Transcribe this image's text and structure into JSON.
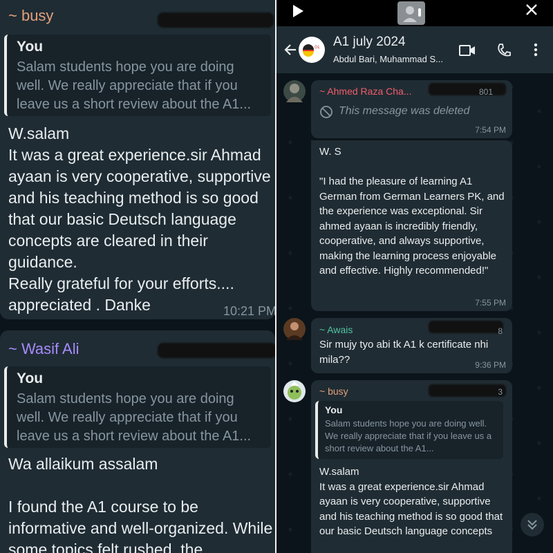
{
  "left": {
    "msg1": {
      "sender": "~ busy",
      "quote_name": "You",
      "quote_text": "Salam students hope you are doing well. We really appreciate that if you leave us a short review about the A1...",
      "body": "W.salam\nIt was a great experience.sir Ahmad ayaan is very cooperative, supportive and his teaching method is so good that our basic Deutsch language concepts are cleared in their guidance.\nReally grateful for your efforts.... appreciated . Danke",
      "time": "10:21 PM"
    },
    "msg2": {
      "sender": "~ Wasif Ali",
      "quote_name": "You",
      "quote_text": "Salam students hope you are doing well. We really appreciate that if you leave us a short review about the A1...",
      "body": "Wa allaikum assalam\n\nI found the A1 course to be informative and well-organized. While some topics felt rushed, the"
    }
  },
  "right": {
    "header": {
      "title": "A1 july 2024",
      "subtitle": "Abdul Bari, Muhammad S...",
      "icons": [
        "back-arrow-icon",
        "video-call-icon",
        "phone-icon",
        "more-vert-icon"
      ]
    },
    "messages": [
      {
        "sender": "~ Ahmed Raza Cha...",
        "phone_tail": "801",
        "text": "This message was deleted",
        "time": "7:54 PM"
      },
      {
        "text": "W. S\n\n\"I had the pleasure of learning A1 German from German Learners PK, and the experience was exceptional. Sir ahmed ayaan is incredibly friendly, cooperative, and always supportive,\nmaking the learning process enjoyable and effective. Highly recommended!\"",
        "time": "7:55 PM"
      },
      {
        "sender": "~ Awais",
        "phone_tail": "8",
        "text": "Sir mujy tyo abi tk A1 k certificate nhi mila??",
        "time": "9:36 PM"
      },
      {
        "sender": "~ busy",
        "phone_tail": "3",
        "quote_name": "You",
        "quote_text": "Salam students hope you are doing well. We really appreciate that if you leave us a short review about the A1...",
        "text": "W.salam\nIt was a great experience.sir Ahmad ayaan is very cooperative, supportive and his teaching method is so good that our basic Deutsch language concepts"
      }
    ]
  },
  "colors": {
    "bubble": "#202c33",
    "background": "#0b141a",
    "sender_busy": "#e2a07a",
    "sender_wasif": "#a78bfa",
    "sender_ahmed": "#f25c6b",
    "sender_awais": "#4fc3a1",
    "timestamp": "#8696a0"
  }
}
